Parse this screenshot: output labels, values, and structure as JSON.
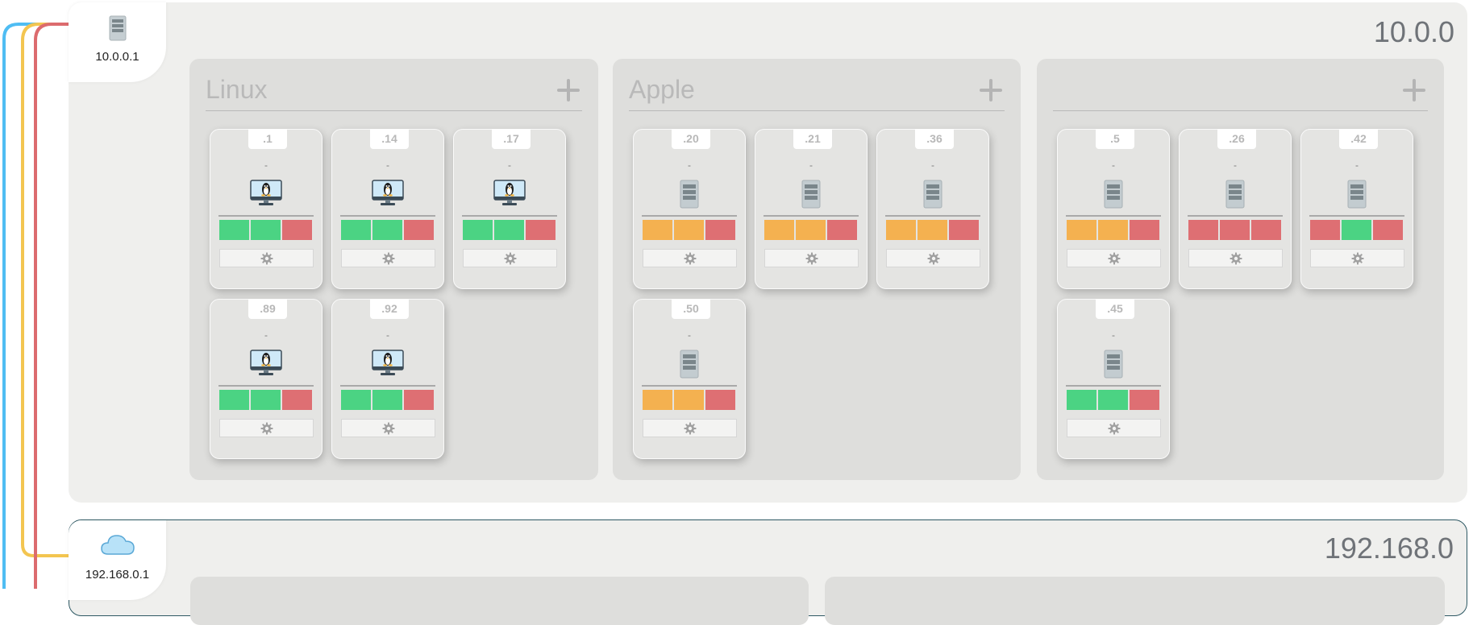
{
  "subnets": [
    {
      "title": "10.0.0",
      "gateway": {
        "ip": "10.0.0.1",
        "icon": "server-icon"
      }
    },
    {
      "title": "192.168.0",
      "gateway": {
        "ip": "192.168.0.1",
        "icon": "cloud-icon"
      }
    }
  ],
  "groups": [
    {
      "title": "Linux",
      "add_label": "+",
      "hosts": [
        {
          "octet": ".1",
          "name": "-",
          "icon": "linux-computer-icon",
          "status": [
            "green",
            "green",
            "red"
          ]
        },
        {
          "octet": ".14",
          "name": "-",
          "icon": "linux-computer-icon",
          "status": [
            "green",
            "green",
            "red"
          ]
        },
        {
          "octet": ".17",
          "name": "-",
          "icon": "linux-computer-icon",
          "status": [
            "green",
            "green",
            "red"
          ]
        },
        {
          "octet": ".89",
          "name": "-",
          "icon": "linux-computer-icon",
          "status": [
            "green",
            "green",
            "red"
          ]
        },
        {
          "octet": ".92",
          "name": "-",
          "icon": "linux-computer-icon",
          "status": [
            "green",
            "green",
            "red"
          ]
        }
      ]
    },
    {
      "title": "Apple",
      "add_label": "+",
      "hosts": [
        {
          "octet": ".20",
          "name": "-",
          "icon": "server-icon",
          "status": [
            "orange",
            "orange",
            "red"
          ]
        },
        {
          "octet": ".21",
          "name": "-",
          "icon": "server-icon",
          "status": [
            "orange",
            "orange",
            "red"
          ]
        },
        {
          "octet": ".36",
          "name": "-",
          "icon": "server-icon",
          "status": [
            "orange",
            "orange",
            "red"
          ]
        },
        {
          "octet": ".50",
          "name": "-",
          "icon": "server-icon",
          "status": [
            "orange",
            "orange",
            "red"
          ]
        }
      ]
    },
    {
      "title": "",
      "add_label": "+",
      "hosts": [
        {
          "octet": ".5",
          "name": "-",
          "icon": "server-icon",
          "status": [
            "orange",
            "orange",
            "red"
          ]
        },
        {
          "octet": ".26",
          "name": "-",
          "icon": "server-icon",
          "status": [
            "red",
            "red",
            "red"
          ]
        },
        {
          "octet": ".42",
          "name": "-",
          "icon": "server-icon",
          "status": [
            "red",
            "green",
            "red"
          ]
        },
        {
          "octet": ".45",
          "name": "-",
          "icon": "server-icon",
          "status": [
            "green",
            "green",
            "red"
          ]
        }
      ]
    }
  ],
  "colors": {
    "green": "#4bd383",
    "orange": "#f4b150",
    "red": "#de6f73",
    "wire_blue": "#4fbdf3",
    "wire_yellow": "#f3c550",
    "wire_red": "#dc6b6e",
    "subnet_border": "#2d5863"
  },
  "settings_icon": "gear-icon"
}
